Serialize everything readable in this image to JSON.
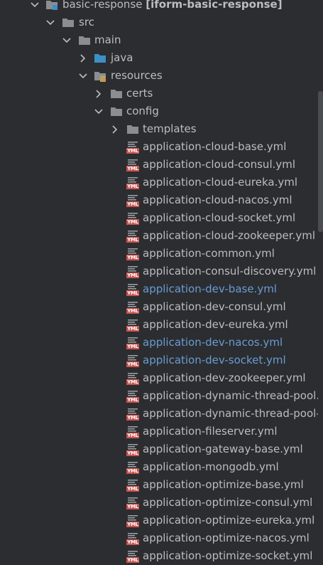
{
  "project_tree": {
    "root": {
      "name": "basic-response",
      "module": "[iform-basic-response]"
    },
    "src": "src",
    "main": "main",
    "java": "java",
    "resources": "resources",
    "certs": "certs",
    "config": "config",
    "templates": "templates",
    "files": [
      {
        "name": "application-cloud-base.yml",
        "modified": false
      },
      {
        "name": "application-cloud-consul.yml",
        "modified": false
      },
      {
        "name": "application-cloud-eureka.yml",
        "modified": false
      },
      {
        "name": "application-cloud-nacos.yml",
        "modified": false
      },
      {
        "name": "application-cloud-socket.yml",
        "modified": false
      },
      {
        "name": "application-cloud-zookeeper.yml",
        "modified": false
      },
      {
        "name": "application-common.yml",
        "modified": false
      },
      {
        "name": "application-consul-discovery.yml",
        "modified": false
      },
      {
        "name": "application-dev-base.yml",
        "modified": true
      },
      {
        "name": "application-dev-consul.yml",
        "modified": false
      },
      {
        "name": "application-dev-eureka.yml",
        "modified": false
      },
      {
        "name": "application-dev-nacos.yml",
        "modified": true
      },
      {
        "name": "application-dev-socket.yml",
        "modified": true
      },
      {
        "name": "application-dev-zookeeper.yml",
        "modified": false
      },
      {
        "name": "application-dynamic-thread-pool.y",
        "modified": false
      },
      {
        "name": "application-dynamic-thread-pool-s",
        "modified": false
      },
      {
        "name": "application-fileserver.yml",
        "modified": false
      },
      {
        "name": "application-gateway-base.yml",
        "modified": false
      },
      {
        "name": "application-mongodb.yml",
        "modified": false
      },
      {
        "name": "application-optimize-base.yml",
        "modified": false
      },
      {
        "name": "application-optimize-consul.yml",
        "modified": false
      },
      {
        "name": "application-optimize-eureka.yml",
        "modified": false
      },
      {
        "name": "application-optimize-nacos.yml",
        "modified": false
      },
      {
        "name": "application-optimize-socket.yml",
        "modified": false
      }
    ],
    "yml_badge": "YML",
    "colors": {
      "background": "#2b2d30",
      "text": "#bbbdc0",
      "modified_text": "#6b9bd2",
      "folder": "#8a8e93",
      "source_folder": "#3d8fc7",
      "yml_badge": "#c75450"
    }
  }
}
